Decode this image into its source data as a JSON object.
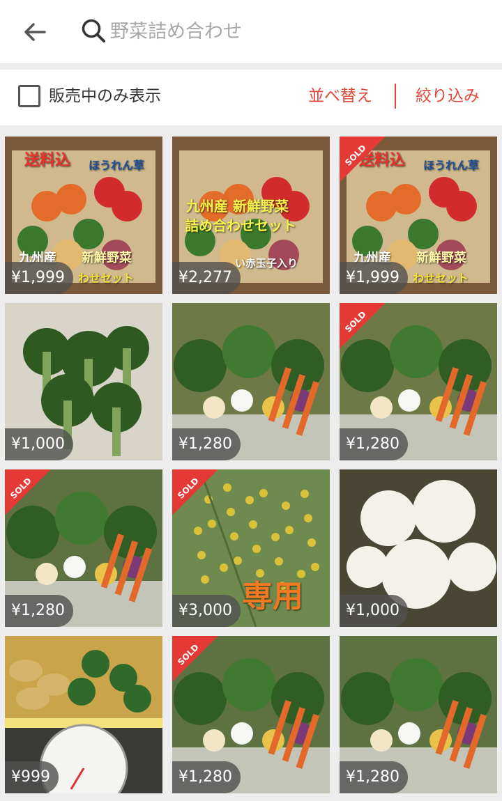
{
  "search": {
    "placeholder": "野菜詰め合わせ"
  },
  "filters": {
    "checkbox_label": "販売中のみ表示",
    "sort_label": "並べ替え",
    "filter_label": "絞り込み"
  },
  "sold_label": "SOLD",
  "items": [
    {
      "price": "¥1,999",
      "sold": false,
      "image": "vegetable-box-photo",
      "overlay": [
        "送料込",
        "ほうれん草",
        "九州産",
        "新鮮野菜",
        "わせセット"
      ]
    },
    {
      "price": "¥2,277",
      "sold": false,
      "image": "vegetable-box-photo",
      "overlay": [
        "九州産 新鮮野菜",
        "詰め合わせセット",
        "い赤玉子入り"
      ]
    },
    {
      "price": "¥1,999",
      "sold": true,
      "image": "vegetable-box-photo",
      "overlay": [
        "送料込",
        "ほうれん草",
        "九州産",
        "新鮮野菜",
        "わせセット"
      ]
    },
    {
      "price": "¥1,000",
      "sold": false,
      "image": "broccoli-photo",
      "overlay": []
    },
    {
      "price": "¥1,280",
      "sold": false,
      "image": "root-vegetables-photo",
      "overlay": []
    },
    {
      "price": "¥1,280",
      "sold": true,
      "image": "root-vegetables-photo",
      "overlay": []
    },
    {
      "price": "¥1,280",
      "sold": true,
      "image": "mixed-vegetables-photo",
      "overlay": []
    },
    {
      "price": "¥3,000",
      "sold": true,
      "image": "fennel-flowers-photo",
      "overlay": [
        "専用"
      ]
    },
    {
      "price": "¥1,000",
      "sold": false,
      "image": "cauliflower-photo",
      "overlay": []
    },
    {
      "price": "¥999",
      "sold": false,
      "image": "vegetables-on-scale-photo",
      "overlay": []
    },
    {
      "price": "¥1,280",
      "sold": true,
      "image": "mixed-vegetables-photo",
      "overlay": []
    },
    {
      "price": "¥1,280",
      "sold": false,
      "image": "mixed-vegetables-photo",
      "overlay": []
    }
  ]
}
